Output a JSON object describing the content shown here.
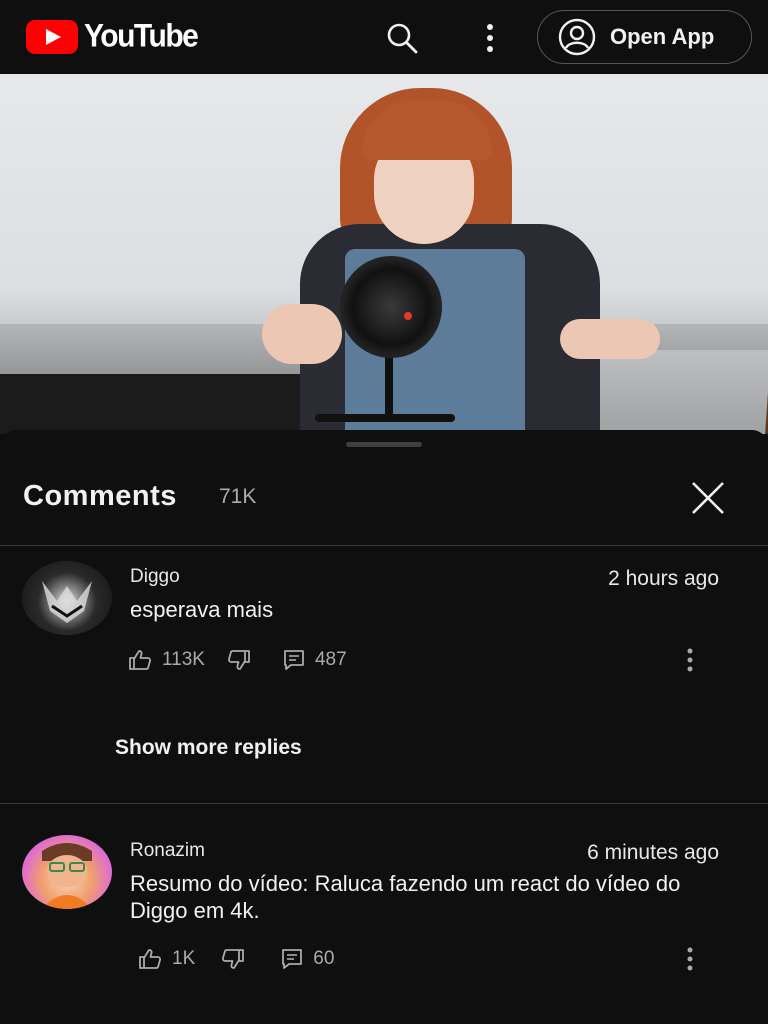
{
  "header": {
    "logo_text": "YouTube",
    "open_app_label": "Open App",
    "brand_color": "#ff0000"
  },
  "comments_panel": {
    "title": "Comments",
    "count": "71K",
    "show_more_replies": "Show more replies",
    "comments": [
      {
        "author": "Diggo",
        "time": "2 hours ago",
        "text": "esperava mais",
        "likes": "113K",
        "replies": "487"
      },
      {
        "author": "Ronazim",
        "time": "6 minutes ago",
        "text": "Resumo do vídeo: Raluca fazendo um react do vídeo do Diggo em 4k.",
        "likes": "1K",
        "replies": "60"
      }
    ]
  },
  "icons": [
    "youtube-logo-icon",
    "search-icon",
    "more-vert-icon",
    "account-icon",
    "close-icon",
    "thumb-up-icon",
    "thumb-down-icon",
    "reply-icon",
    "comment-more-icon"
  ]
}
